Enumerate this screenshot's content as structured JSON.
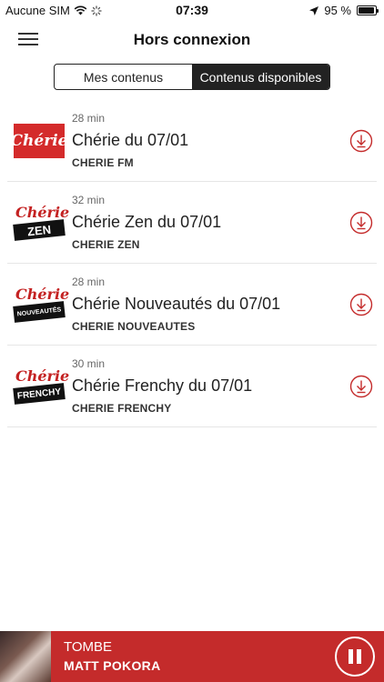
{
  "status": {
    "carrier": "Aucune SIM",
    "time": "07:39",
    "battery": "95 %",
    "battery_level": 0.95
  },
  "header": {
    "title": "Hors connexion"
  },
  "tabs": [
    {
      "label": "Mes contenus",
      "active": false
    },
    {
      "label": "Contenus disponibles",
      "active": true
    }
  ],
  "items": [
    {
      "duration": "28 min",
      "title": "Chérie du 07/01",
      "subtitle": "CHERIE FM",
      "logo_text": "Chérie"
    },
    {
      "duration": "32 min",
      "title": "Chérie Zen du 07/01",
      "subtitle": "CHERIE ZEN",
      "logo_text": "Chérie",
      "logo_band": "ZEN"
    },
    {
      "duration": "28 min",
      "title": "Chérie Nouveautés du 07/01",
      "subtitle": "CHERIE NOUVEAUTES",
      "logo_text": "Chérie",
      "logo_band": "NOUVEAUTÉS"
    },
    {
      "duration": "30 min",
      "title": "Chérie Frenchy du 07/01",
      "subtitle": "CHERIE FRENCHY",
      "logo_text": "Chérie",
      "logo_band": "FRENCHY"
    }
  ],
  "player": {
    "track": "TOMBE",
    "artist": "MATT POKORA"
  },
  "colors": {
    "accent": "#c42b2b",
    "dark": "#222222"
  },
  "icons": {
    "menu": "hamburger-menu-icon",
    "download": "download-circle-icon",
    "pause": "pause-icon"
  }
}
